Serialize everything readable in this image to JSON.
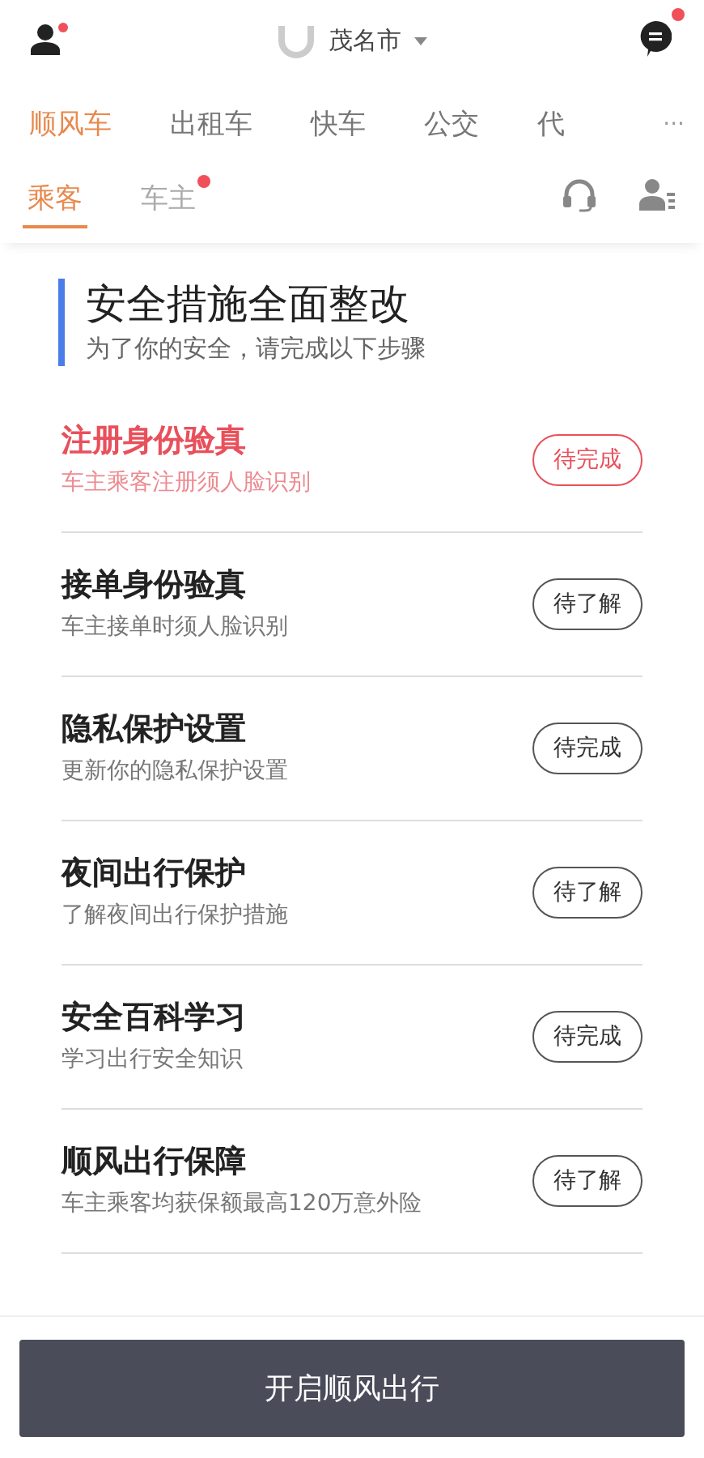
{
  "header": {
    "city": "茂名市",
    "profile_badge": true,
    "message_badge": true
  },
  "tabs": [
    {
      "label": "顺风车",
      "selected": true
    },
    {
      "label": "出租车",
      "selected": false
    },
    {
      "label": "快车",
      "selected": false
    },
    {
      "label": "公交",
      "selected": false
    },
    {
      "label": "代",
      "selected": false
    }
  ],
  "more": "···",
  "sub_tabs": [
    {
      "label": "乘客",
      "selected": true,
      "badge": false
    },
    {
      "label": "车主",
      "selected": false,
      "badge": true
    }
  ],
  "safety": {
    "title": "安全措施全面整改",
    "subtitle": "为了你的安全，请完成以下步骤",
    "steps": [
      {
        "title": "注册身份验真",
        "desc": "车主乘客注册须人脸识别",
        "action": "待完成",
        "highlighted": true
      },
      {
        "title": "接单身份验真",
        "desc": "车主接单时须人脸识别",
        "action": "待了解",
        "highlighted": false
      },
      {
        "title": "隐私保护设置",
        "desc": "更新你的隐私保护设置",
        "action": "待完成",
        "highlighted": false
      },
      {
        "title": "夜间出行保护",
        "desc": "了解夜间出行保护措施",
        "action": "待了解",
        "highlighted": false
      },
      {
        "title": "安全百科学习",
        "desc": "学习出行安全知识",
        "action": "待完成",
        "highlighted": false
      },
      {
        "title": "顺风出行保障",
        "desc": "车主乘客均获保额最高120万意外险",
        "action": "待了解",
        "highlighted": false
      }
    ]
  },
  "start_button": "开启顺风出行"
}
